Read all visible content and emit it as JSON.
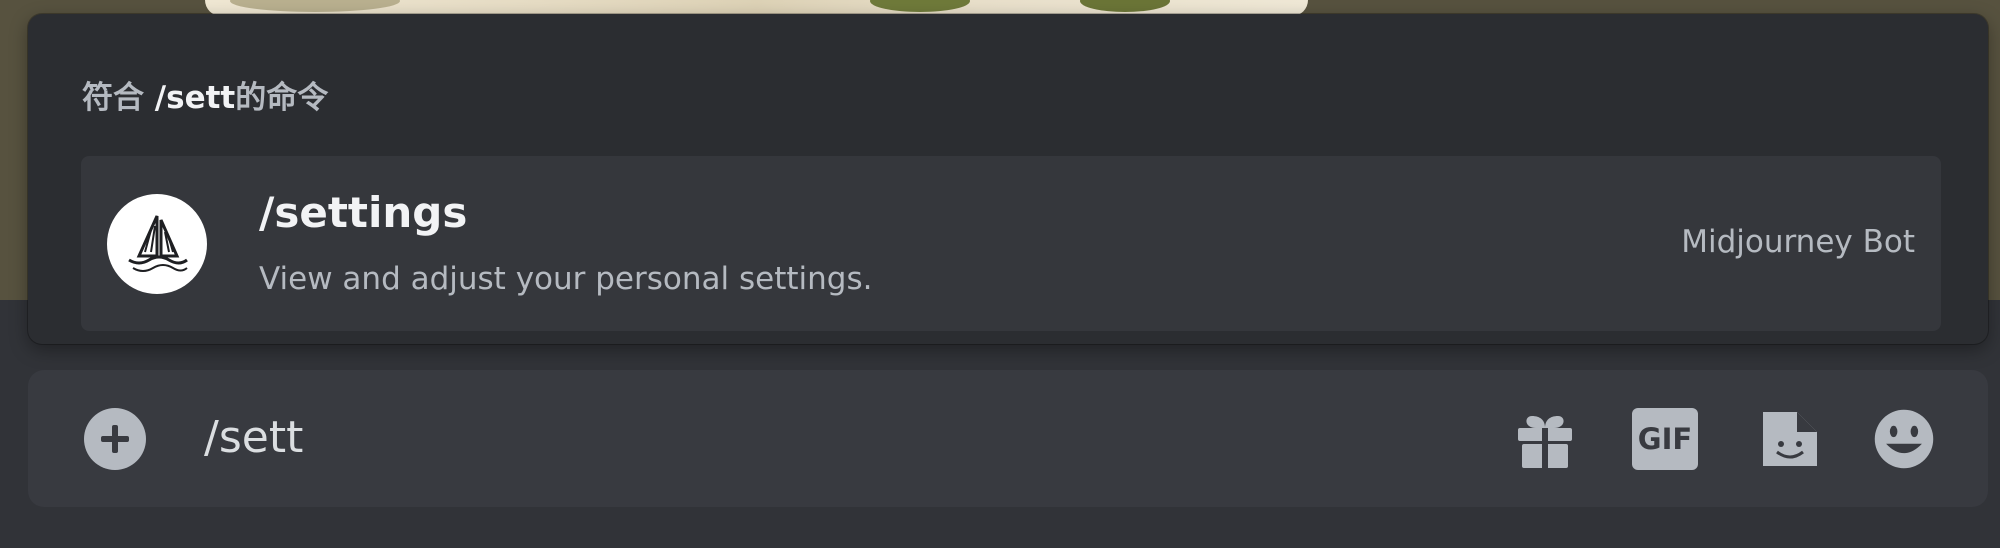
{
  "popup": {
    "title_prefix": "符合",
    "title_command": "/sett",
    "title_suffix": "的命令"
  },
  "command": {
    "name": "/settings",
    "description": "View and adjust your personal settings.",
    "source": "Midjourney Bot",
    "avatar_icon": "sailboat-icon"
  },
  "composer": {
    "value": "/sett",
    "buttons": {
      "add": "plus-circle-icon",
      "gift": "gift-icon",
      "gif_label": "GIF",
      "sticker": "sticker-icon",
      "emoji": "emoji-icon"
    }
  },
  "colors": {
    "background": "#313338",
    "popup": "#2b2d31",
    "row_highlight": "#35373c",
    "composer": "#383a40",
    "icon": "#b5bac1",
    "text_primary": "#f2f3f5",
    "text_muted": "#b5bac1"
  }
}
